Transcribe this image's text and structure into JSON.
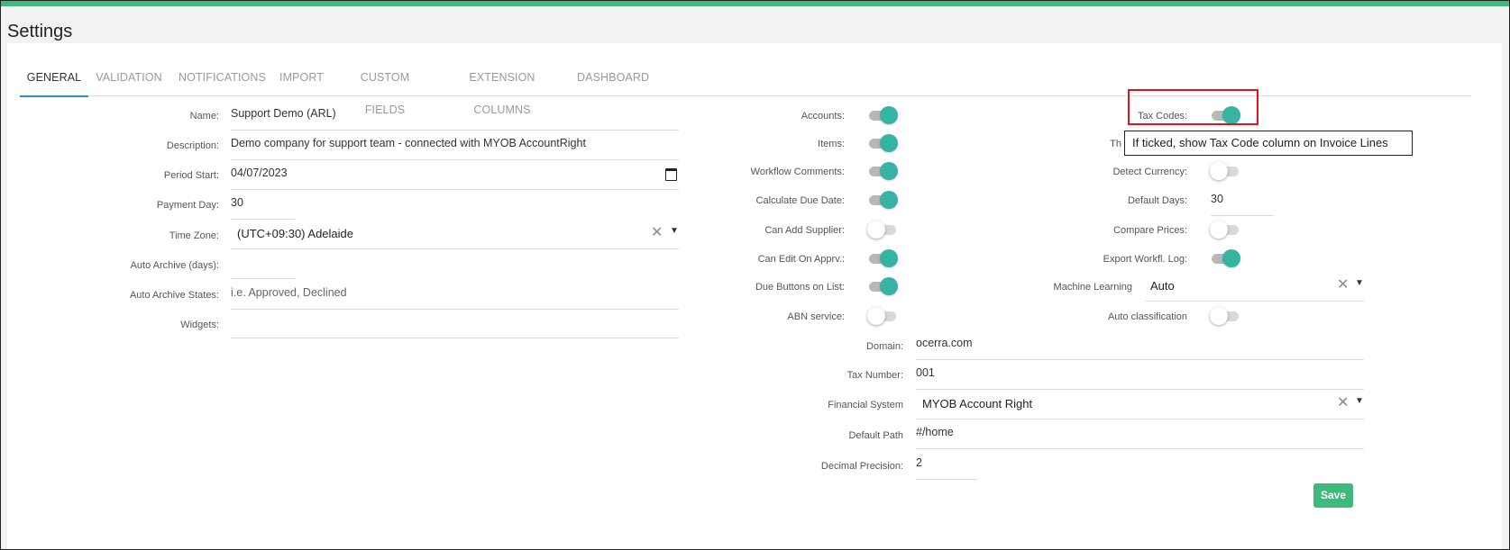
{
  "page": {
    "title": "Settings"
  },
  "tabs": [
    "GENERAL",
    "VALIDATION",
    "NOTIFICATIONS",
    "IMPORT",
    "CUSTOM FIELDS",
    "EXTENSION COLUMNS",
    "DASHBOARD"
  ],
  "general": {
    "name": {
      "label": "Name:",
      "value": "Support Demo (ARL)"
    },
    "description": {
      "label": "Description:",
      "value": "Demo company for support team - connected with MYOB AccountRight"
    },
    "period_start": {
      "label": "Period Start:",
      "value": "04/07/2023"
    },
    "payment_day": {
      "label": "Payment Day:",
      "value": "30"
    },
    "time_zone": {
      "label": "Time Zone:",
      "value": "(UTC+09:30) Adelaide"
    },
    "auto_archive_days": {
      "label": "Auto Archive (days):",
      "value": ""
    },
    "auto_archive_states": {
      "label": "Auto Archive States:",
      "placeholder": "i.e. Approved, Declined"
    },
    "widgets": {
      "label": "Widgets:",
      "value": ""
    }
  },
  "toggles_mid": [
    {
      "label": "Accounts:",
      "on": true
    },
    {
      "label": "Items:",
      "on": true
    },
    {
      "label": "Workflow Comments:",
      "on": true
    },
    {
      "label": "Calculate Due Date:",
      "on": true
    },
    {
      "label": "Can Add Supplier:",
      "on": false
    },
    {
      "label": "Can Edit On Apprv.:",
      "on": true
    },
    {
      "label": "Due Buttons on List:",
      "on": true
    },
    {
      "label": "ABN service:",
      "on": false
    }
  ],
  "right": {
    "tax_codes": {
      "label": "Tax Codes:",
      "on": true
    },
    "hidden_label": "Th",
    "detect_currency": {
      "label": "Detect Currency:",
      "on": false
    },
    "default_days": {
      "label": "Default Days:",
      "value": "30"
    },
    "compare_prices": {
      "label": "Compare Prices:",
      "on": false
    },
    "export_workflow_log": {
      "label": "Export Workfl. Log:",
      "on": true
    },
    "machine_learning": {
      "label": "Machine Learning",
      "value": "Auto"
    },
    "auto_classification": {
      "label": "Auto classification",
      "on": false
    }
  },
  "system": {
    "domain": {
      "label": "Domain:",
      "value": "ocerra.com"
    },
    "tax_number": {
      "label": "Tax Number:",
      "value": "001"
    },
    "financial_system": {
      "label": "Financial System",
      "value": "MYOB Account Right"
    },
    "default_path": {
      "label": "Default Path",
      "value": "#/home"
    },
    "decimal_precision": {
      "label": "Decimal Precision:",
      "value": "2"
    }
  },
  "tooltip": "If ticked, show Tax Code column on Invoice Lines",
  "buttons": {
    "save": "Save"
  },
  "colors": {
    "accent": "#3dba7c",
    "toggle_on": "#36b3a2",
    "tab_active": "#2196c9",
    "highlight": "#e01414"
  }
}
